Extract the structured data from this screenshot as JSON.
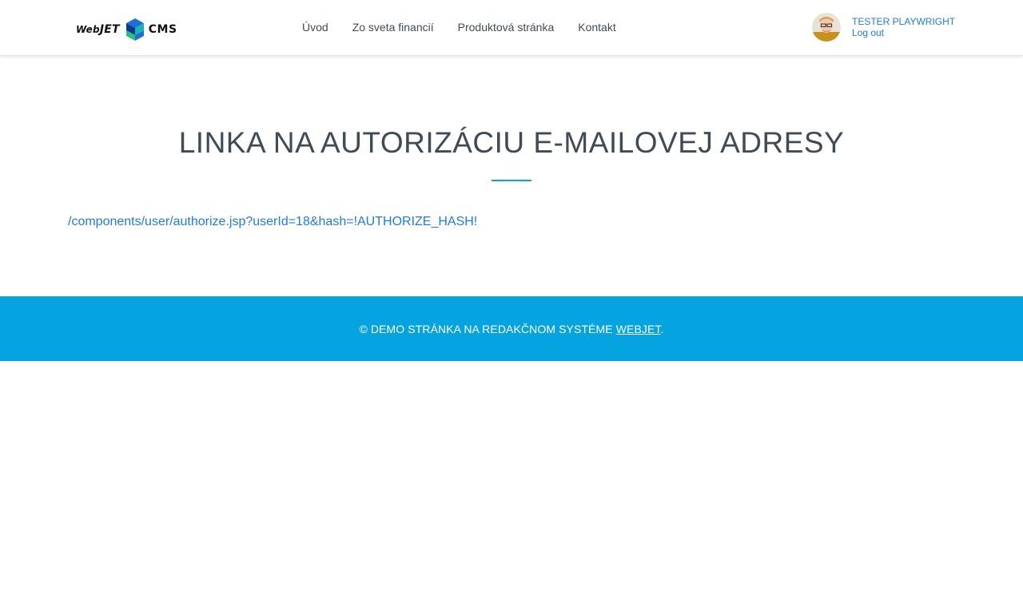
{
  "header": {
    "logo": {
      "word_web": "Web",
      "word_jet": "JET",
      "word_cms": "CMS",
      "cube_colors": [
        "#1c6fd6",
        "#18b5b0",
        "#0b3a8c",
        "#26c07a"
      ]
    },
    "nav": [
      {
        "label": "Úvod"
      },
      {
        "label": "Zo sveta financií"
      },
      {
        "label": "Produktová stránka"
      },
      {
        "label": "Kontakt"
      }
    ],
    "user": {
      "name": "TESTER PLAYWRIGHT",
      "logout_label": "Log out",
      "avatar_icon": "user-avatar-icon"
    }
  },
  "main": {
    "title": "LINKA NA AUTORIZÁCIU E-MAILOVEJ ADRESY",
    "link": "/components/user/authorize.jsp?userId=18&hash=!AUTHORIZE_HASH!"
  },
  "footer": {
    "prefix": "© DEMO STRÁNKA NA REDAKČNOM SYSTÉME ",
    "link_label": "WEBJET",
    "suffix": "."
  },
  "colors": {
    "accent": "#05a3e0",
    "link": "#1f7cd6",
    "text": "#3f4b55"
  }
}
